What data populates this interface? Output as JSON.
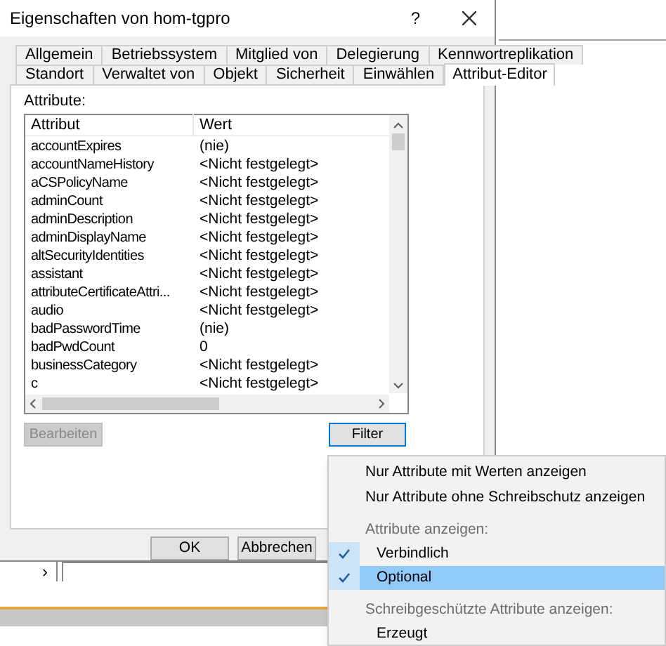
{
  "window": {
    "title": "Eigenschaften von hom-tgpro",
    "help": "?"
  },
  "tabs": [
    [
      {
        "label": "Allgemein",
        "selected": false
      },
      {
        "label": "Betriebssystem",
        "selected": false
      },
      {
        "label": "Mitglied von",
        "selected": false
      },
      {
        "label": "Delegierung",
        "selected": false
      },
      {
        "label": "Kennwortreplikation",
        "selected": false
      }
    ],
    [
      {
        "label": "Standort",
        "selected": false
      },
      {
        "label": "Verwaltet von",
        "selected": false
      },
      {
        "label": "Objekt",
        "selected": false
      },
      {
        "label": "Sicherheit",
        "selected": false
      },
      {
        "label": "Einwählen",
        "selected": false
      },
      {
        "label": "Attribut-Editor",
        "selected": true
      }
    ]
  ],
  "attributes_label": "Attribute:",
  "table": {
    "columns": [
      "Attribut",
      "Wert"
    ],
    "rows": [
      {
        "attribute": "accountExpires",
        "value": "(nie)"
      },
      {
        "attribute": "accountNameHistory",
        "value": "<Nicht festgelegt>"
      },
      {
        "attribute": "aCSPolicyName",
        "value": "<Nicht festgelegt>"
      },
      {
        "attribute": "adminCount",
        "value": "<Nicht festgelegt>"
      },
      {
        "attribute": "adminDescription",
        "value": "<Nicht festgelegt>"
      },
      {
        "attribute": "adminDisplayName",
        "value": "<Nicht festgelegt>"
      },
      {
        "attribute": "altSecurityIdentities",
        "value": "<Nicht festgelegt>"
      },
      {
        "attribute": "assistant",
        "value": "<Nicht festgelegt>"
      },
      {
        "attribute": "attributeCertificateAttri...",
        "value": "<Nicht festgelegt>"
      },
      {
        "attribute": "audio",
        "value": "<Nicht festgelegt>"
      },
      {
        "attribute": "badPasswordTime",
        "value": "(nie)"
      },
      {
        "attribute": "badPwdCount",
        "value": "0"
      },
      {
        "attribute": "businessCategory",
        "value": "<Nicht festgelegt>"
      },
      {
        "attribute": "c",
        "value": "<Nicht festgelegt>"
      }
    ]
  },
  "edit_button": {
    "label": "Bearbeiten",
    "disabled": true
  },
  "filter_button": {
    "label": "Filter"
  },
  "footer_buttons": [
    "OK",
    "Abbrechen"
  ],
  "background": {
    "chevron": "›"
  },
  "menu": [
    {
      "kind": "item",
      "label": "Nur Attribute mit Werten anzeigen"
    },
    {
      "kind": "item",
      "label": "Nur Attribute ohne Schreibschutz anzeigen"
    },
    {
      "kind": "separator"
    },
    {
      "kind": "header",
      "label": "Attribute anzeigen:"
    },
    {
      "kind": "check",
      "label": "Verbindlich",
      "checked": true,
      "selected": false
    },
    {
      "kind": "check",
      "label": "Optional",
      "checked": true,
      "selected": true
    },
    {
      "kind": "separator"
    },
    {
      "kind": "header",
      "label": "Schreibgeschützte Attribute anzeigen:"
    },
    {
      "kind": "check",
      "label": "Erzeugt",
      "checked": false,
      "selected": false
    }
  ]
}
